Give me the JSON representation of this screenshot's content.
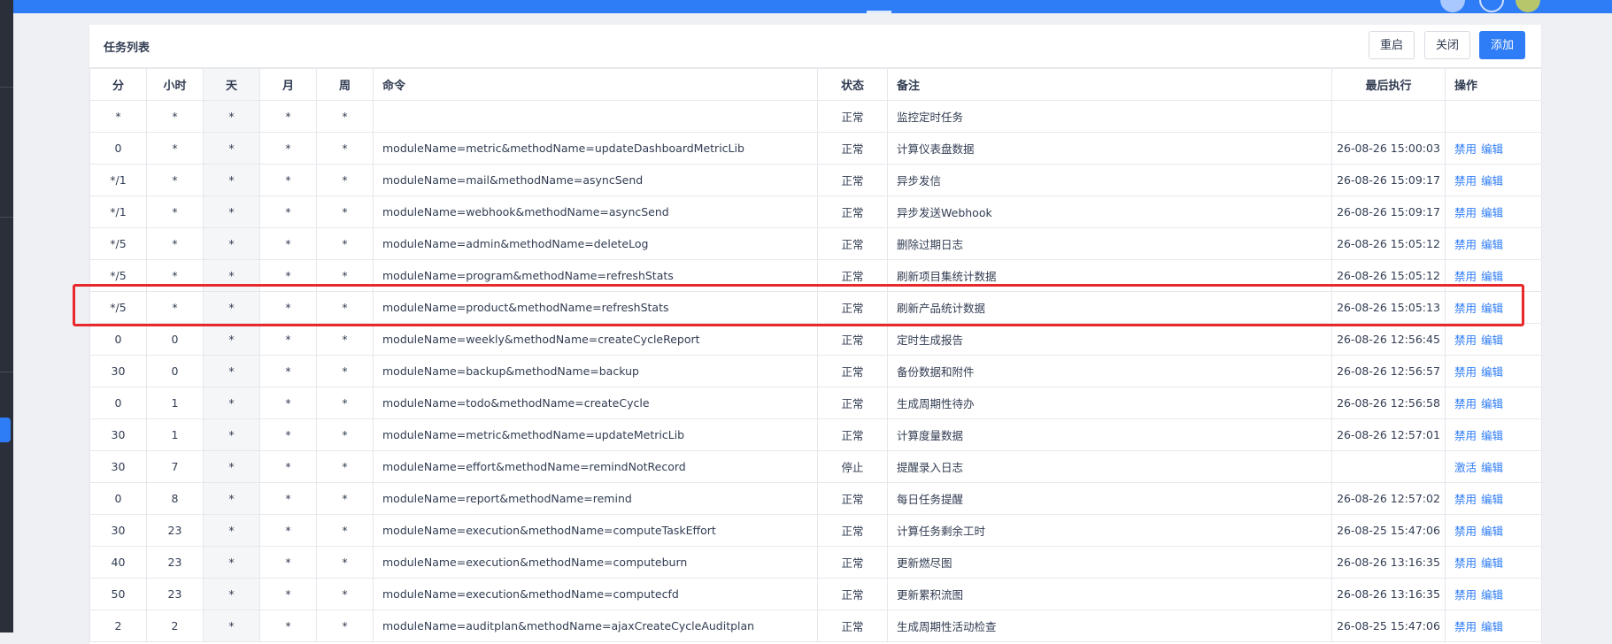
{
  "colors": {
    "accent": "#2e7cf6",
    "highlight": "#e8282b"
  },
  "panel": {
    "title": "任务列表",
    "buttons": {
      "restart": "重启",
      "close": "关闭",
      "add": "添加"
    }
  },
  "columns": [
    "分",
    "小时",
    "天",
    "月",
    "周",
    "命令",
    "状态",
    "备注",
    "最后执行",
    "操作"
  ],
  "rows": [
    {
      "min": "*",
      "hour": "*",
      "day": "*",
      "month": "*",
      "week": "*",
      "command": "",
      "status": "正常",
      "remark": "监控定时任务",
      "last": "",
      "actions": []
    },
    {
      "min": "0",
      "hour": "*",
      "day": "*",
      "month": "*",
      "week": "*",
      "command": "moduleName=metric&methodName=updateDashboardMetricLib",
      "status": "正常",
      "remark": "计算仪表盘数据",
      "last": "26-08-26 15:00:03",
      "actions": [
        "禁用",
        "编辑"
      ]
    },
    {
      "min": "*/1",
      "hour": "*",
      "day": "*",
      "month": "*",
      "week": "*",
      "command": "moduleName=mail&methodName=asyncSend",
      "status": "正常",
      "remark": "异步发信",
      "last": "26-08-26 15:09:17",
      "actions": [
        "禁用",
        "编辑"
      ]
    },
    {
      "min": "*/1",
      "hour": "*",
      "day": "*",
      "month": "*",
      "week": "*",
      "command": "moduleName=webhook&methodName=asyncSend",
      "status": "正常",
      "remark": "异步发送Webhook",
      "last": "26-08-26 15:09:17",
      "actions": [
        "禁用",
        "编辑"
      ]
    },
    {
      "min": "*/5",
      "hour": "*",
      "day": "*",
      "month": "*",
      "week": "*",
      "command": "moduleName=admin&methodName=deleteLog",
      "status": "正常",
      "remark": "删除过期日志",
      "last": "26-08-26 15:05:12",
      "actions": [
        "禁用",
        "编辑"
      ]
    },
    {
      "min": "*/5",
      "hour": "*",
      "day": "*",
      "month": "*",
      "week": "*",
      "command": "moduleName=program&methodName=refreshStats",
      "status": "正常",
      "remark": "刷新项目集统计数据",
      "last": "26-08-26 15:05:12",
      "actions": [
        "禁用",
        "编辑"
      ]
    },
    {
      "min": "*/5",
      "hour": "*",
      "day": "*",
      "month": "*",
      "week": "*",
      "command": "moduleName=product&methodName=refreshStats",
      "status": "正常",
      "remark": "刷新产品统计数据",
      "last": "26-08-26 15:05:13",
      "actions": [
        "禁用",
        "编辑"
      ]
    },
    {
      "min": "0",
      "hour": "0",
      "day": "*",
      "month": "*",
      "week": "*",
      "command": "moduleName=weekly&methodName=createCycleReport",
      "status": "正常",
      "remark": "定时生成报告",
      "last": "26-08-26 12:56:45",
      "actions": [
        "禁用",
        "编辑"
      ]
    },
    {
      "min": "30",
      "hour": "0",
      "day": "*",
      "month": "*",
      "week": "*",
      "command": "moduleName=backup&methodName=backup",
      "status": "正常",
      "remark": "备份数据和附件",
      "last": "26-08-26 12:56:57",
      "actions": [
        "禁用",
        "编辑"
      ]
    },
    {
      "min": "0",
      "hour": "1",
      "day": "*",
      "month": "*",
      "week": "*",
      "command": "moduleName=todo&methodName=createCycle",
      "status": "正常",
      "remark": "生成周期性待办",
      "last": "26-08-26 12:56:58",
      "actions": [
        "禁用",
        "编辑"
      ]
    },
    {
      "min": "30",
      "hour": "1",
      "day": "*",
      "month": "*",
      "week": "*",
      "command": "moduleName=metric&methodName=updateMetricLib",
      "status": "正常",
      "remark": "计算度量数据",
      "last": "26-08-26 12:57:01",
      "actions": [
        "禁用",
        "编辑"
      ]
    },
    {
      "min": "30",
      "hour": "7",
      "day": "*",
      "month": "*",
      "week": "*",
      "command": "moduleName=effort&methodName=remindNotRecord",
      "status": "停止",
      "remark": "提醒录入日志",
      "last": "",
      "actions": [
        "激活",
        "编辑"
      ]
    },
    {
      "min": "0",
      "hour": "8",
      "day": "*",
      "month": "*",
      "week": "*",
      "command": "moduleName=report&methodName=remind",
      "status": "正常",
      "remark": "每日任务提醒",
      "last": "26-08-26 12:57:02",
      "actions": [
        "禁用",
        "编辑"
      ]
    },
    {
      "min": "30",
      "hour": "23",
      "day": "*",
      "month": "*",
      "week": "*",
      "command": "moduleName=execution&methodName=computeTaskEffort",
      "status": "正常",
      "remark": "计算任务剩余工时",
      "last": "26-08-25 15:47:06",
      "actions": [
        "禁用",
        "编辑"
      ]
    },
    {
      "min": "40",
      "hour": "23",
      "day": "*",
      "month": "*",
      "week": "*",
      "command": "moduleName=execution&methodName=computeburn",
      "status": "正常",
      "remark": "更新燃尽图",
      "last": "26-08-26 13:16:35",
      "actions": [
        "禁用",
        "编辑"
      ]
    },
    {
      "min": "50",
      "hour": "23",
      "day": "*",
      "month": "*",
      "week": "*",
      "command": "moduleName=execution&methodName=computecfd",
      "status": "正常",
      "remark": "更新累积流图",
      "last": "26-08-26 13:16:35",
      "actions": [
        "禁用",
        "编辑"
      ]
    },
    {
      "min": "2",
      "hour": "2",
      "day": "*",
      "month": "*",
      "week": "*",
      "command": "moduleName=auditplan&methodName=ajaxCreateCycleAuditplan",
      "status": "正常",
      "remark": "生成周期性活动检查",
      "last": "26-08-25 15:47:06",
      "actions": [
        "禁用",
        "编辑"
      ]
    }
  ]
}
